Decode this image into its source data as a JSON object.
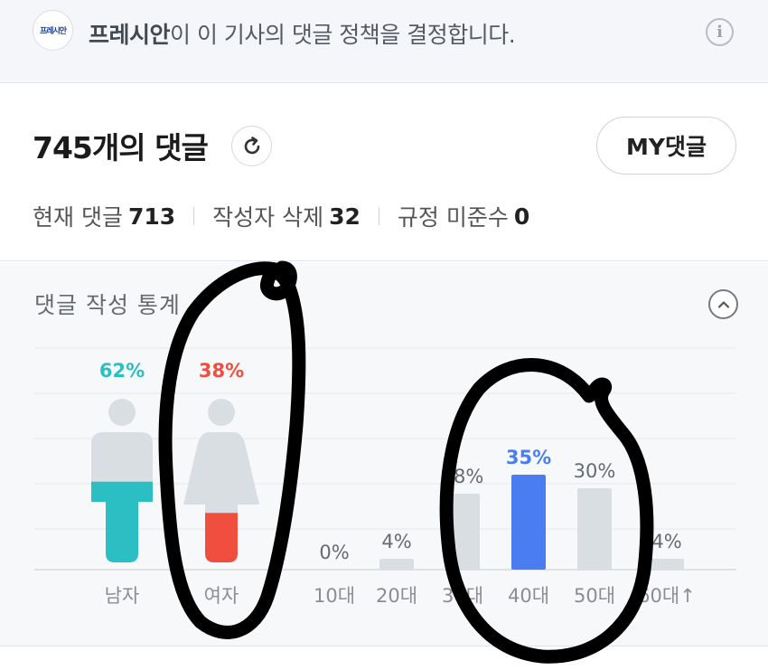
{
  "banner": {
    "press_logo": "프레시안",
    "press_name": "프레시안",
    "message": "이 이 기사의 댓글 정책을 결정합니다.",
    "info_icon": "info-icon"
  },
  "comments": {
    "count_title": "745개의 댓글",
    "refresh_icon": "refresh-icon",
    "my_button": "MY댓글",
    "current_label": "현재 댓글",
    "current_value": "713",
    "deleted_label": "작성자 삭제",
    "deleted_value": "32",
    "violation_label": "규정 미준수",
    "violation_value": "0"
  },
  "stats": {
    "title": "댓글 작성 통계",
    "collapse_icon": "chevron-up-icon"
  },
  "chart_data": [
    {
      "type": "bar",
      "categories": [
        "남자",
        "여자"
      ],
      "values": [
        62,
        38
      ],
      "value_labels": [
        "62%",
        "38%"
      ],
      "colors": [
        "#2bbec2",
        "#f04e3e"
      ],
      "ylim": [
        0,
        100
      ]
    },
    {
      "type": "bar",
      "categories": [
        "10대",
        "20대",
        "30대",
        "40대",
        "50대",
        "60대↑"
      ],
      "values": [
        0,
        4,
        28,
        35,
        30,
        4
      ],
      "value_labels": [
        "0%",
        "4%",
        "28%",
        "35%",
        "30%",
        "4%"
      ],
      "highlight_color": "#4a7df0",
      "bar_color": "#d9dee3",
      "ylim": [
        0,
        40
      ]
    }
  ],
  "colors": {
    "male": "#2bbec2",
    "female": "#f04e3e",
    "highlight": "#4a7df0",
    "bar": "#d9dee3",
    "annotation": "#000000"
  }
}
